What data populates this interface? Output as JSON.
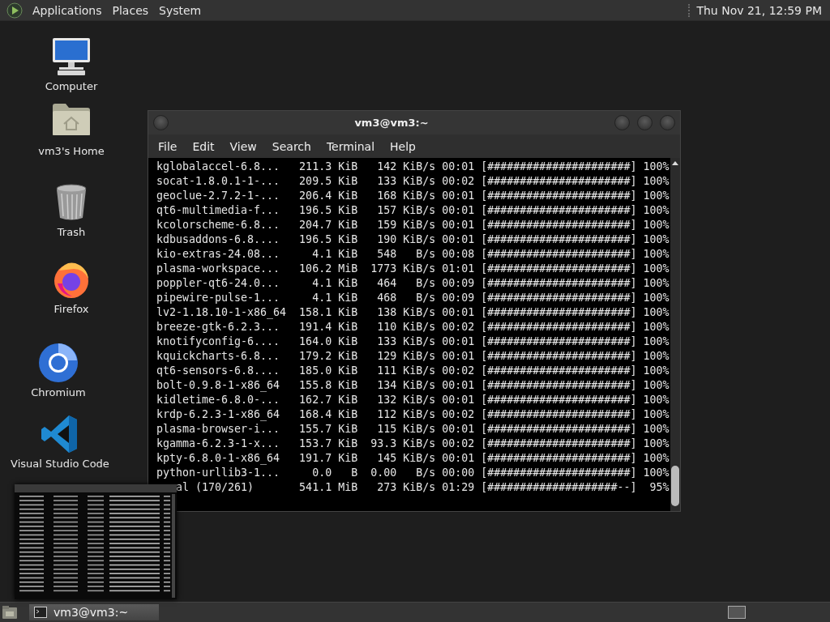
{
  "top_panel": {
    "menus": [
      "Applications",
      "Places",
      "System"
    ],
    "clock": "Thu Nov 21, 12:59 PM"
  },
  "desktop_icons": [
    {
      "label": "Computer",
      "kind": "computer"
    },
    {
      "label": "vm3's Home",
      "kind": "home"
    },
    {
      "label": "Trash",
      "kind": "trash"
    },
    {
      "label": "Firefox",
      "kind": "firefox"
    },
    {
      "label": "Chromium",
      "kind": "chromium"
    },
    {
      "label": "Visual Studio Code",
      "kind": "vscode"
    }
  ],
  "terminal": {
    "title": "vm3@vm3:~",
    "menus": [
      "File",
      "Edit",
      "View",
      "Search",
      "Terminal",
      "Help"
    ],
    "lines": [
      "kglobalaccel-6.8...   211.3 KiB   142 KiB/s 00:01 [######################] 100%",
      "socat-1.8.0.1-1-...   209.5 KiB   133 KiB/s 00:02 [######################] 100%",
      "geoclue-2.7.2-1-...   206.4 KiB   168 KiB/s 00:01 [######################] 100%",
      "qt6-multimedia-f...   196.5 KiB   157 KiB/s 00:01 [######################] 100%",
      "kcolorscheme-6.8...   204.7 KiB   159 KiB/s 00:01 [######################] 100%",
      "kdbusaddons-6.8....   196.5 KiB   190 KiB/s 00:01 [######################] 100%",
      "kio-extras-24.08...     4.1 KiB   548   B/s 00:08 [######################] 100%",
      "plasma-workspace...   106.2 MiB  1773 KiB/s 01:01 [######################] 100%",
      "poppler-qt6-24.0...     4.1 KiB   464   B/s 00:09 [######################] 100%",
      "pipewire-pulse-1...     4.1 KiB   468   B/s 00:09 [######################] 100%",
      "lv2-1.18.10-1-x86_64  158.1 KiB   138 KiB/s 00:01 [######################] 100%",
      "breeze-gtk-6.2.3...   191.4 KiB   110 KiB/s 00:02 [######################] 100%",
      "knotifyconfig-6....   164.0 KiB   133 KiB/s 00:01 [######################] 100%",
      "kquickcharts-6.8...   179.2 KiB   129 KiB/s 00:01 [######################] 100%",
      "qt6-sensors-6.8....   185.0 KiB   111 KiB/s 00:02 [######################] 100%",
      "bolt-0.9.8-1-x86_64   155.8 KiB   134 KiB/s 00:01 [######################] 100%",
      "kidletime-6.8.0-...   162.7 KiB   132 KiB/s 00:01 [######################] 100%",
      "krdp-6.2.3-1-x86_64   168.4 KiB   112 KiB/s 00:02 [######################] 100%",
      "plasma-browser-i...   155.7 KiB   115 KiB/s 00:01 [######################] 100%",
      "kgamma-6.2.3-1-x...   153.7 KiB  93.3 KiB/s 00:02 [######################] 100%",
      "kpty-6.8.0-1-x86_64   191.7 KiB   145 KiB/s 00:01 [######################] 100%",
      "python-urllib3-1...     0.0   B  0.00   B/s 00:00 [######################] 100%",
      "   al (170/261)       541.1 MiB   273 KiB/s 01:29 [####################--]  95%"
    ]
  },
  "taskbar": {
    "tasks": [
      {
        "label": "vm3@vm3:~",
        "selected": true
      }
    ]
  }
}
